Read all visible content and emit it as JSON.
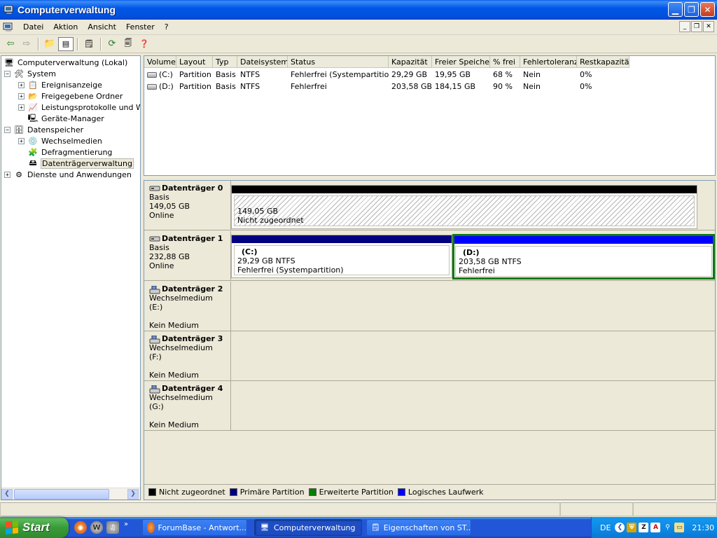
{
  "window": {
    "title": "Computerverwaltung"
  },
  "menu": {
    "items": [
      "Datei",
      "Aktion",
      "Ansicht",
      "Fenster",
      "?"
    ]
  },
  "toolbar": {
    "icons": [
      "back-arrow-icon",
      "forward-arrow-icon",
      "up-folder-icon",
      "show-hide-tree-icon",
      "properties-icon",
      "refresh-icon",
      "export-list-icon",
      "help-icon"
    ]
  },
  "tree": {
    "items": [
      {
        "label": "Computerverwaltung (Lokal)",
        "icon": "computer-icon"
      },
      {
        "label": "System",
        "icon": "tools-icon"
      },
      {
        "label": "Ereignisanzeige",
        "icon": "event-viewer-icon"
      },
      {
        "label": "Freigegebene Ordner",
        "icon": "shared-folder-icon"
      },
      {
        "label": "Leistungsprotokolle und Warn",
        "icon": "performance-icon"
      },
      {
        "label": "Geräte-Manager",
        "icon": "device-manager-icon"
      },
      {
        "label": "Datenspeicher",
        "icon": "storage-icon"
      },
      {
        "label": "Wechselmedien",
        "icon": "removable-storage-icon"
      },
      {
        "label": "Defragmentierung",
        "icon": "defrag-icon"
      },
      {
        "label": "Datenträgerverwaltung",
        "icon": "disk-management-icon"
      },
      {
        "label": "Dienste und Anwendungen",
        "icon": "services-icon"
      }
    ]
  },
  "volumes": {
    "columns": [
      "Volume",
      "Layout",
      "Typ",
      "Dateisystem",
      "Status",
      "Kapazität",
      "Freier Speicher",
      "% frei",
      "Fehlertoleranz",
      "Restkapazität"
    ],
    "rows": [
      [
        "(C:)",
        "Partition",
        "Basis",
        "NTFS",
        "Fehlerfrei (Systempartition)",
        "29,29 GB",
        "19,95 GB",
        "68 %",
        "Nein",
        "0%"
      ],
      [
        "(D:)",
        "Partition",
        "Basis",
        "NTFS",
        "Fehlerfrei",
        "203,58 GB",
        "184,15 GB",
        "90 %",
        "Nein",
        "0%"
      ]
    ]
  },
  "disks": [
    {
      "name": "Datenträger 0",
      "line1": "Basis",
      "line2": "149,05 GB",
      "line3": "Online",
      "partitions": [
        {
          "title": "",
          "size": "149,05 GB",
          "status": "Nicht zugeordnet"
        }
      ]
    },
    {
      "name": "Datenträger 1",
      "line1": "Basis",
      "line2": "232,88 GB",
      "line3": "Online",
      "partitions": [
        {
          "title": "(C:)",
          "size": "29,29 GB NTFS",
          "status": "Fehlerfrei (Systempartition)"
        },
        {
          "title": "(D:)",
          "size": "203,58 GB NTFS",
          "status": "Fehlerfrei"
        }
      ]
    },
    {
      "name": "Datenträger 2",
      "line1": "Wechselmedium (E:)",
      "line2": "",
      "line3": "Kein Medium",
      "partitions": []
    },
    {
      "name": "Datenträger 3",
      "line1": "Wechselmedium (F:)",
      "line2": "",
      "line3": "Kein Medium",
      "partitions": []
    },
    {
      "name": "Datenträger 4",
      "line1": "Wechselmedium (G:)",
      "line2": "",
      "line3": "Kein Medium",
      "partitions": []
    }
  ],
  "legend": [
    {
      "label": "Nicht zugeordnet",
      "color": "#000000"
    },
    {
      "label": "Primäre Partition",
      "color": "#000080"
    },
    {
      "label": "Erweiterte Partition",
      "color": "#008000"
    },
    {
      "label": "Logisches Laufwerk",
      "color": "#0000ff"
    }
  ],
  "colors": {
    "unallocated": "#000000",
    "primary": "#000080",
    "logical": "#0000ff",
    "extended": "#008000",
    "titlebar": "#0058e6"
  },
  "taskbar": {
    "start_label": "Start",
    "quicklaunch": [
      "firefox-icon",
      "winamp-icon",
      "media-icon"
    ],
    "tasks": [
      {
        "label": "ForumBase - Antwort...",
        "icon": "firefox-icon",
        "active": false
      },
      {
        "label": "Computerverwaltung",
        "icon": "computer-management-icon",
        "active": true
      },
      {
        "label": "Eigenschaften von ST...",
        "icon": "properties-icon",
        "active": false
      }
    ],
    "tray": {
      "lang": "DE",
      "clock": "21:30",
      "icons": [
        "tray-expand-icon",
        "shield-icon",
        "zonealarm-icon",
        "antivir-icon",
        "network-icon",
        "device-icon"
      ]
    }
  }
}
